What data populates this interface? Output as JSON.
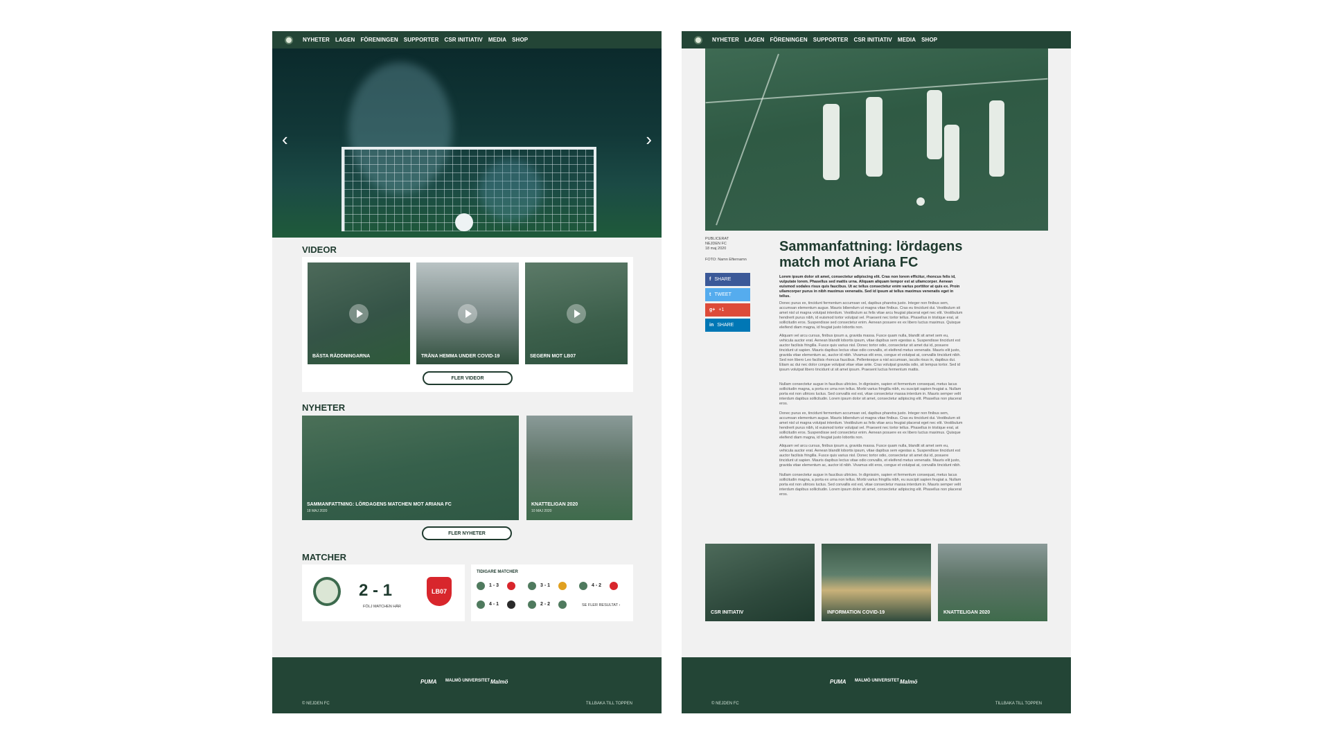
{
  "nav": [
    "NYHETER",
    "LAGEN",
    "FÖRENINGEN",
    "SUPPORTER",
    "CSR INITIATIV",
    "MEDIA",
    "SHOP"
  ],
  "home": {
    "videos_title": "VIDEOR",
    "videos": [
      {
        "caption": "BÄSTA RÄDDNINGARNA"
      },
      {
        "caption": "TRÄNA HEMMA UNDER COVID-19"
      },
      {
        "caption": "SEGERN MOT LB07"
      }
    ],
    "more_videos": "FLER VIDEOR",
    "news_title": "NYHETER",
    "news": [
      {
        "caption": "SAMMANFATTNING: LÖRDAGENS MATCHEN MOT ARIANA FC",
        "date": "18 MAJ 2020"
      },
      {
        "caption": "KNATTELIGAN 2020",
        "date": "10 MAJ 2020"
      }
    ],
    "more_news": "FLER NYHETER",
    "matches_title": "MATCHER",
    "live_score": "2 - 1",
    "follow": "FÖLJ MATCHEN HÄR",
    "away_badge": "LB07",
    "previous_title": "TIDIGARE MATCHER",
    "previous": [
      "1 - 3",
      "3 - 1",
      "4 - 2",
      "4 - 1",
      "2 - 2"
    ],
    "more_results": "SE FLER RESULTAT ›"
  },
  "article": {
    "published_label": "PUBLICERAT",
    "author": "NEJDEN FC",
    "date": "18 maj 2020",
    "photo": "FOTO: Namn Efternamn",
    "share": [
      {
        "icon": "f",
        "label": "SHARE",
        "color": "#3b5998"
      },
      {
        "icon": "t",
        "label": "TWEET",
        "color": "#55acee"
      },
      {
        "icon": "g+",
        "label": "+1",
        "color": "#dd4b39"
      },
      {
        "icon": "in",
        "label": "SHARE",
        "color": "#0077b5"
      }
    ],
    "title": "Sammanfattning: lördagens match mot Ariana FC",
    "lead": "Lorem ipsum dolor sit amet, consectetur adipiscing elit. Cras non lorem efficitur, rhoncus felis id, vulputate lorem. Phasellus sed mattis urna. Aliquam aliquam tempor est at ullamcorper. Aenean euismod sodales risus quis faucibus. Ut ac tellus consectetur enim varius porttitor at quis ex. Proin ullamcorper purus in nibh maximus venenatis. Sed id ipsum at tellus maximus venenatis eget in tellus.",
    "paragraphs": [
      "Donec purus ex, tincidunt fermentum accumsan vel, dapibus pharetra justo. Integer non finibus sem, accumsan elementum augue. Mauris bibendum ut magna vitae finibus. Cras eu tincidunt dui. Vestibulum sit amet nisl ut magna volutpat interdum. Vestibulum ac felis vitae arcu feugiat placerat eget nec elit. Vestibulum hendrerit purus nibh, id euismod tortor volutpat vel. Praesent nec tortor tellus. Phasellus in tristique erat, at sollicitudin eros. Suspendisse sed consectetur enim. Aenean posuere ex ex libero luctus maximus. Quisque eleifend diam magna, id feugiat justo lobortis non.",
      "Aliquam vel arcu cursus, finibus ipsum a, gravida massa. Fusce quam nulla, blandit sit amet sem eu, vehicula auctor erat. Aenean blandit lobortis ipsum, vitae dapibus sem egestas a. Suspendisse tincidunt est auctor facilisis fringilla. Fusce quis varius nisl. Donec tortor odio, consectetur sit amet dui id, posuere tincidunt ut sapien. Mauris dapibus lectus vitae odio convallis, et eleifend metus venenatis. Mauris elit justo, gravida vitae elementum ac, auctor id nibh. Vivamus elit eros, congue et volutpat at, convallis tincidunt nibh. Sed non libero Leo facilisis rhoncus faucibus. Pellentesque a nisl accumsan, iaculis risus in, dapibus dui. Etiam ac dui nec dolor congue volutpat vitae vitae ante. Cras volutpat gravida odio, sit tempus tortor. Sed id ipsum volutpat libero tincidunt ut sit amet ipsum. Praesent luctus fermentum mattis.",
      "Nullam consectetur augue in faucibus ultricies. In dignissim, sapien et fermentum consequat, metus lacus sollicitudin magna, a porta ex urna non tellus. Morbi varius fringilla nibh, eu suscipit sapien feugiat a. Nullam porta est non ultrices luctus. Sed convallis est est, vitae consectetur massa interdum in. Mauris semper velit interdum dapibus sollicitudin. Lorem ipsum dolor sit amet, consectetur adipiscing elit. Phasellus non placerat eros.",
      "Donec purus ex, tincidunt fermentum accumsan vel, dapibus pharetra justo. Integer non finibus sem, accumsan elementum augue. Mauris bibendum ut magna vitae finibus. Cras eu tincidunt dui. Vestibulum sit amet nisl ut magna volutpat interdum. Vestibulum ac felis vitae arcu feugiat placerat eget nec elit. Vestibulum hendrerit purus nibh, id euismod tortor volutpat vel. Praesent nec tortor tellus. Phasellus in tristique erat, at sollicitudin eros. Suspendisse sed consectetur enim. Aenean posuere ex ex libero luctus maximus. Quisque eleifend diam magna, id feugiat justo lobortis non.",
      "Aliquam vel arcu cursus, finibus ipsum a, gravida massa. Fusce quam nulla, blandit sit amet sem eu, vehicula auctor erat. Aenean blandit lobortis ipsum, vitae dapibus sem egestas a. Suspendisse tincidunt est auctor facilisis fringilla. Fusce quis varius nisl. Donec tortor odio, consectetur sit amet dui id, posuere tincidunt ut sapien. Mauris dapibus lectus vitae odio convallis, et eleifend metus venenatis. Mauris elit justo, gravida vitae elementum ac, auctor id nibh. Vivamus elit eros, congue et volutpat at, convallis tincidunt nibh.",
      "Nullam consectetur augue in faucibus ultricies. In dignissim, sapien et fermentum consequat, metus lacus sollicitudin magna, a porta ex urna non tellus. Morbi varius fringilla nibh, eu suscipit sapien feugiat a. Nullam porta est non ultrices luctus. Sed convallis est est, vitae consectetur massa interdum in. Mauris semper velit interdum dapibus sollicitudin. Lorem ipsum dolor sit amet, consectetur adipiscing elit. Phasellus non placerat eros."
    ],
    "related": [
      {
        "caption": "CSR INITIATIV"
      },
      {
        "caption": "INFORMATION COVID-19"
      },
      {
        "caption": "KNATTELIGAN 2020"
      }
    ]
  },
  "footer": {
    "sponsors": [
      "PUMA",
      "MALMÖ UNIVERSITET",
      "Malmö"
    ],
    "copyright": "© NEJDEN FC",
    "back_to_top": "TILLBAKA TILL TOPPEN"
  }
}
